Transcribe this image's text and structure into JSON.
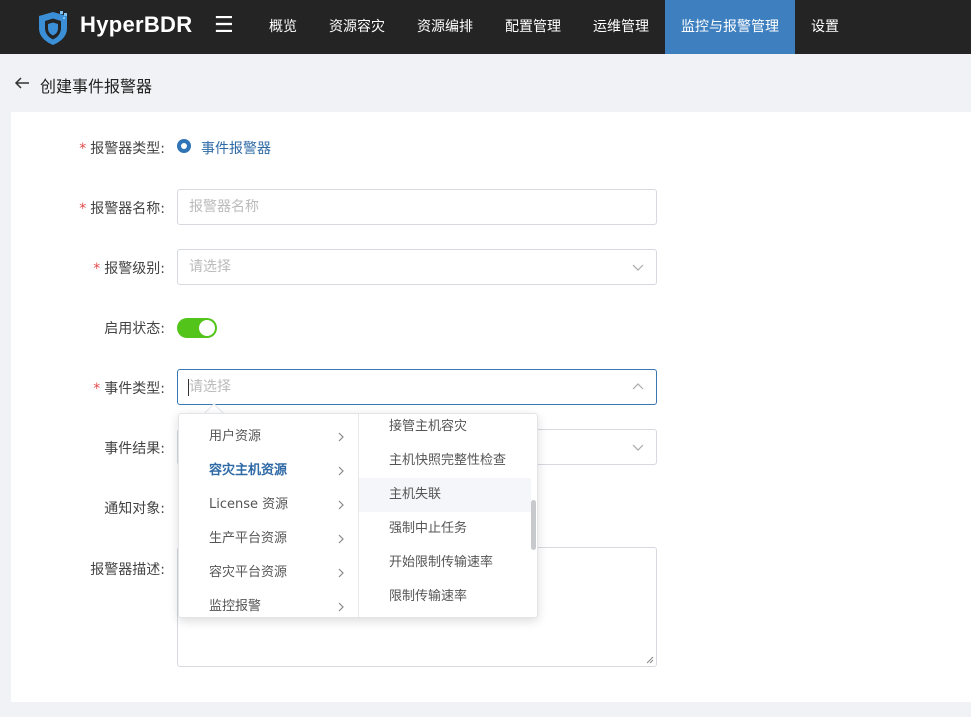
{
  "app": {
    "brand": "HyperBDR"
  },
  "nav": {
    "items": [
      "概览",
      "资源容灾",
      "资源编排",
      "配置管理",
      "运维管理",
      "监控与报警管理",
      "设置"
    ],
    "active_index": 5
  },
  "colors": {
    "accent": "#3d7fbf",
    "toggle_on": "#52c41a",
    "required": "#e04848",
    "topbar": "#242424"
  },
  "page": {
    "title": "创建事件报警器"
  },
  "form": {
    "alarm_type": {
      "label": "报警器类型:",
      "option": "事件报警器"
    },
    "alarm_name": {
      "label": "报警器名称:",
      "placeholder": "报警器名称"
    },
    "alarm_level": {
      "label": "报警级别:",
      "placeholder": "请选择"
    },
    "enabled": {
      "label": "启用状态:",
      "value": true
    },
    "event_type": {
      "label": "事件类型:",
      "placeholder": "请选择"
    },
    "event_result": {
      "label": "事件结果:"
    },
    "notify_target": {
      "label": "通知对象:"
    },
    "description": {
      "label": "报警器描述:"
    }
  },
  "cascader": {
    "level1": [
      "用户资源",
      "容灾主机资源",
      "License 资源",
      "生产平台资源",
      "容灾平台资源",
      "监控报警"
    ],
    "level1_active": 1,
    "level2": [
      "接管主机容灾",
      "主机快照完整性检查",
      "主机失联",
      "强制中止任务",
      "开始限制传输速率",
      "限制传输速率"
    ],
    "level2_hover": 2
  }
}
